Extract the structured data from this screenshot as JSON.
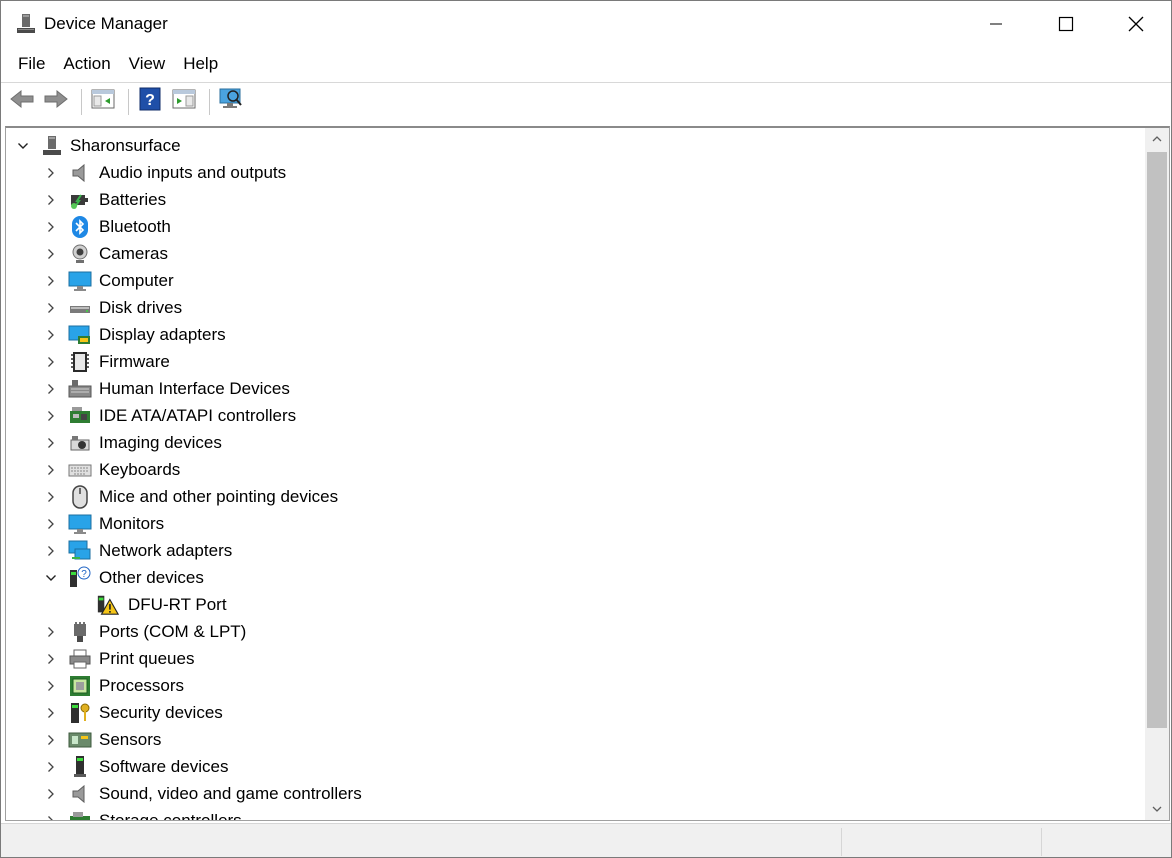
{
  "window": {
    "title": "Device Manager",
    "icon": "device-manager-icon"
  },
  "menu": [
    "File",
    "Action",
    "View",
    "Help"
  ],
  "toolbar": {
    "buttons": [
      "back-icon",
      "forward-icon",
      "show-hide-console-tree-icon",
      "help-icon",
      "properties-pane-icon",
      "scan-hardware-icon"
    ]
  },
  "tree": {
    "root": {
      "label": "Sharonsurface",
      "icon": "computer-tower-icon",
      "expanded": true
    },
    "categories": [
      {
        "label": "Audio inputs and outputs",
        "icon": "speaker-icon",
        "expanded": false
      },
      {
        "label": "Batteries",
        "icon": "battery-icon",
        "expanded": false
      },
      {
        "label": "Bluetooth",
        "icon": "bluetooth-icon",
        "expanded": false
      },
      {
        "label": "Cameras",
        "icon": "camera-icon",
        "expanded": false
      },
      {
        "label": "Computer",
        "icon": "computer-monitor-icon",
        "expanded": false
      },
      {
        "label": "Disk drives",
        "icon": "disk-drive-icon",
        "expanded": false
      },
      {
        "label": "Display adapters",
        "icon": "display-adapter-icon",
        "expanded": false
      },
      {
        "label": "Firmware",
        "icon": "firmware-chip-icon",
        "expanded": false
      },
      {
        "label": "Human Interface Devices",
        "icon": "hid-icon",
        "expanded": false
      },
      {
        "label": "IDE ATA/ATAPI controllers",
        "icon": "ide-controller-icon",
        "expanded": false
      },
      {
        "label": "Imaging devices",
        "icon": "imaging-device-icon",
        "expanded": false
      },
      {
        "label": "Keyboards",
        "icon": "keyboard-icon",
        "expanded": false
      },
      {
        "label": "Mice and other pointing devices",
        "icon": "mouse-icon",
        "expanded": false
      },
      {
        "label": "Monitors",
        "icon": "monitor-icon",
        "expanded": false
      },
      {
        "label": "Network adapters",
        "icon": "network-adapter-icon",
        "expanded": false
      },
      {
        "label": "Other devices",
        "icon": "unknown-device-icon",
        "expanded": true,
        "children": [
          {
            "label": "DFU-RT Port",
            "icon": "warning-device-icon"
          }
        ]
      },
      {
        "label": "Ports (COM & LPT)",
        "icon": "port-icon",
        "expanded": false
      },
      {
        "label": "Print queues",
        "icon": "printer-icon",
        "expanded": false
      },
      {
        "label": "Processors",
        "icon": "processor-icon",
        "expanded": false
      },
      {
        "label": "Security devices",
        "icon": "security-key-icon",
        "expanded": false
      },
      {
        "label": "Sensors",
        "icon": "sensor-icon",
        "expanded": false
      },
      {
        "label": "Software devices",
        "icon": "software-device-icon",
        "expanded": false
      },
      {
        "label": "Sound, video and game controllers",
        "icon": "sound-controller-icon",
        "expanded": false
      },
      {
        "label": "Storage controllers",
        "icon": "storage-controller-icon",
        "expanded": false
      }
    ]
  },
  "colors": {
    "accent_blue": "#1e88e5",
    "warning_yellow": "#f5c518",
    "scroll_thumb": "#c1c1c1"
  }
}
